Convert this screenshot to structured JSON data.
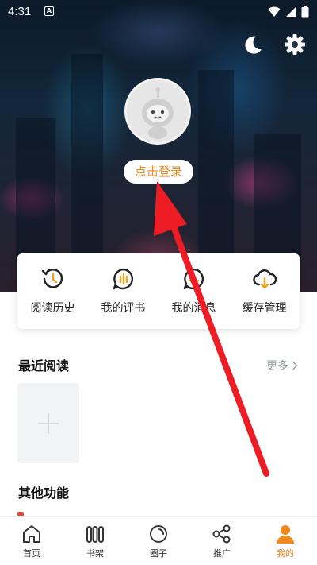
{
  "status_bar": {
    "time": "4:31",
    "notification_icon_label": "A"
  },
  "header": {
    "login_label": "点击登录"
  },
  "shortcuts": [
    {
      "label": "阅读历史",
      "icon": "history-icon"
    },
    {
      "label": "我的评书",
      "icon": "comment-icon"
    },
    {
      "label": "我的消息",
      "icon": "message-icon"
    },
    {
      "label": "缓存管理",
      "icon": "cloud-download-icon"
    }
  ],
  "recent": {
    "title": "最近阅读",
    "more_label": "更多"
  },
  "other": {
    "title": "其他功能"
  },
  "nav": [
    {
      "label": "首页",
      "icon": "home-icon"
    },
    {
      "label": "书架",
      "icon": "bookshelf-icon"
    },
    {
      "label": "圈子",
      "icon": "circle-icon"
    },
    {
      "label": "推广",
      "icon": "share-icon"
    },
    {
      "label": "我的",
      "icon": "profile-icon"
    }
  ],
  "active_nav_index": 4,
  "colors": {
    "accent": "#f08a1d",
    "annotation_arrow": "#ee1c24"
  }
}
